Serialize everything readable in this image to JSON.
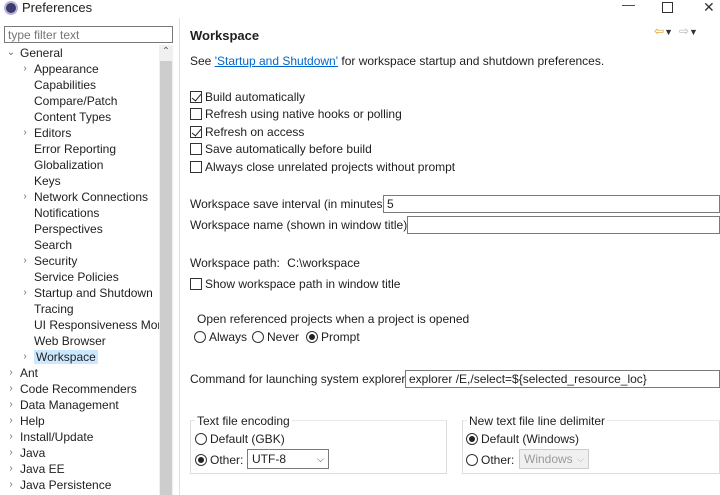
{
  "window": {
    "title": "Preferences",
    "minimize": "—",
    "maximize": "",
    "close": "✕"
  },
  "filter": {
    "placeholder": "type filter text"
  },
  "tree": {
    "general": "General",
    "children": [
      "Appearance",
      "Capabilities",
      "Compare/Patch",
      "Content Types",
      "Editors",
      "Error Reporting",
      "Globalization",
      "Keys",
      "Network Connections",
      "Notifications",
      "Perspectives",
      "Search",
      "Security",
      "Service Policies",
      "Startup and Shutdown",
      "Tracing",
      "UI Responsiveness Monitoring",
      "Web Browser",
      "Workspace"
    ],
    "roots": [
      "Ant",
      "Code Recommenders",
      "Data Management",
      "Help",
      "Install/Update",
      "Java",
      "Java EE",
      "Java Persistence"
    ]
  },
  "page": {
    "title": "Workspace",
    "see_prefix": "See ",
    "see_link": "'Startup and Shutdown'",
    "see_suffix": " for workspace startup and shutdown preferences.",
    "options": [
      {
        "label": "Build automatically",
        "checked": true
      },
      {
        "label": "Refresh using native hooks or polling",
        "checked": false
      },
      {
        "label": "Refresh on access",
        "checked": true
      },
      {
        "label": "Save automatically before build",
        "checked": false
      },
      {
        "label": "Always close unrelated projects without prompt",
        "checked": false
      }
    ],
    "save_interval_label": "Workspace save interval (in minutes):",
    "save_interval_value": "5",
    "workspace_name_label": "Workspace name (shown in window title):",
    "workspace_name_value": "",
    "workspace_path_label": "Workspace path:",
    "workspace_path_value": "C:\\workspace",
    "show_path_label": "Show workspace path in window title",
    "open_ref_title": "Open referenced projects when a project is opened",
    "open_ref_options": [
      "Always",
      "Never",
      "Prompt"
    ],
    "explorer_label": "Command for launching system explorer:",
    "explorer_value": "explorer /E,/select=${selected_resource_loc}",
    "encoding_title": "Text file encoding",
    "encoding_default": "Default (GBK)",
    "encoding_other": "Other:",
    "encoding_value": "UTF-8",
    "delimiter_title": "New text file line delimiter",
    "delimiter_default": "Default (Windows)",
    "delimiter_other": "Other:",
    "delimiter_value": "Windows"
  },
  "colors": {
    "link": "#0066cc",
    "selection": "#cce8ff",
    "nav_back": "#e0a020"
  },
  "icons": {
    "back": "arrow-left-icon",
    "forward": "arrow-right-icon"
  }
}
